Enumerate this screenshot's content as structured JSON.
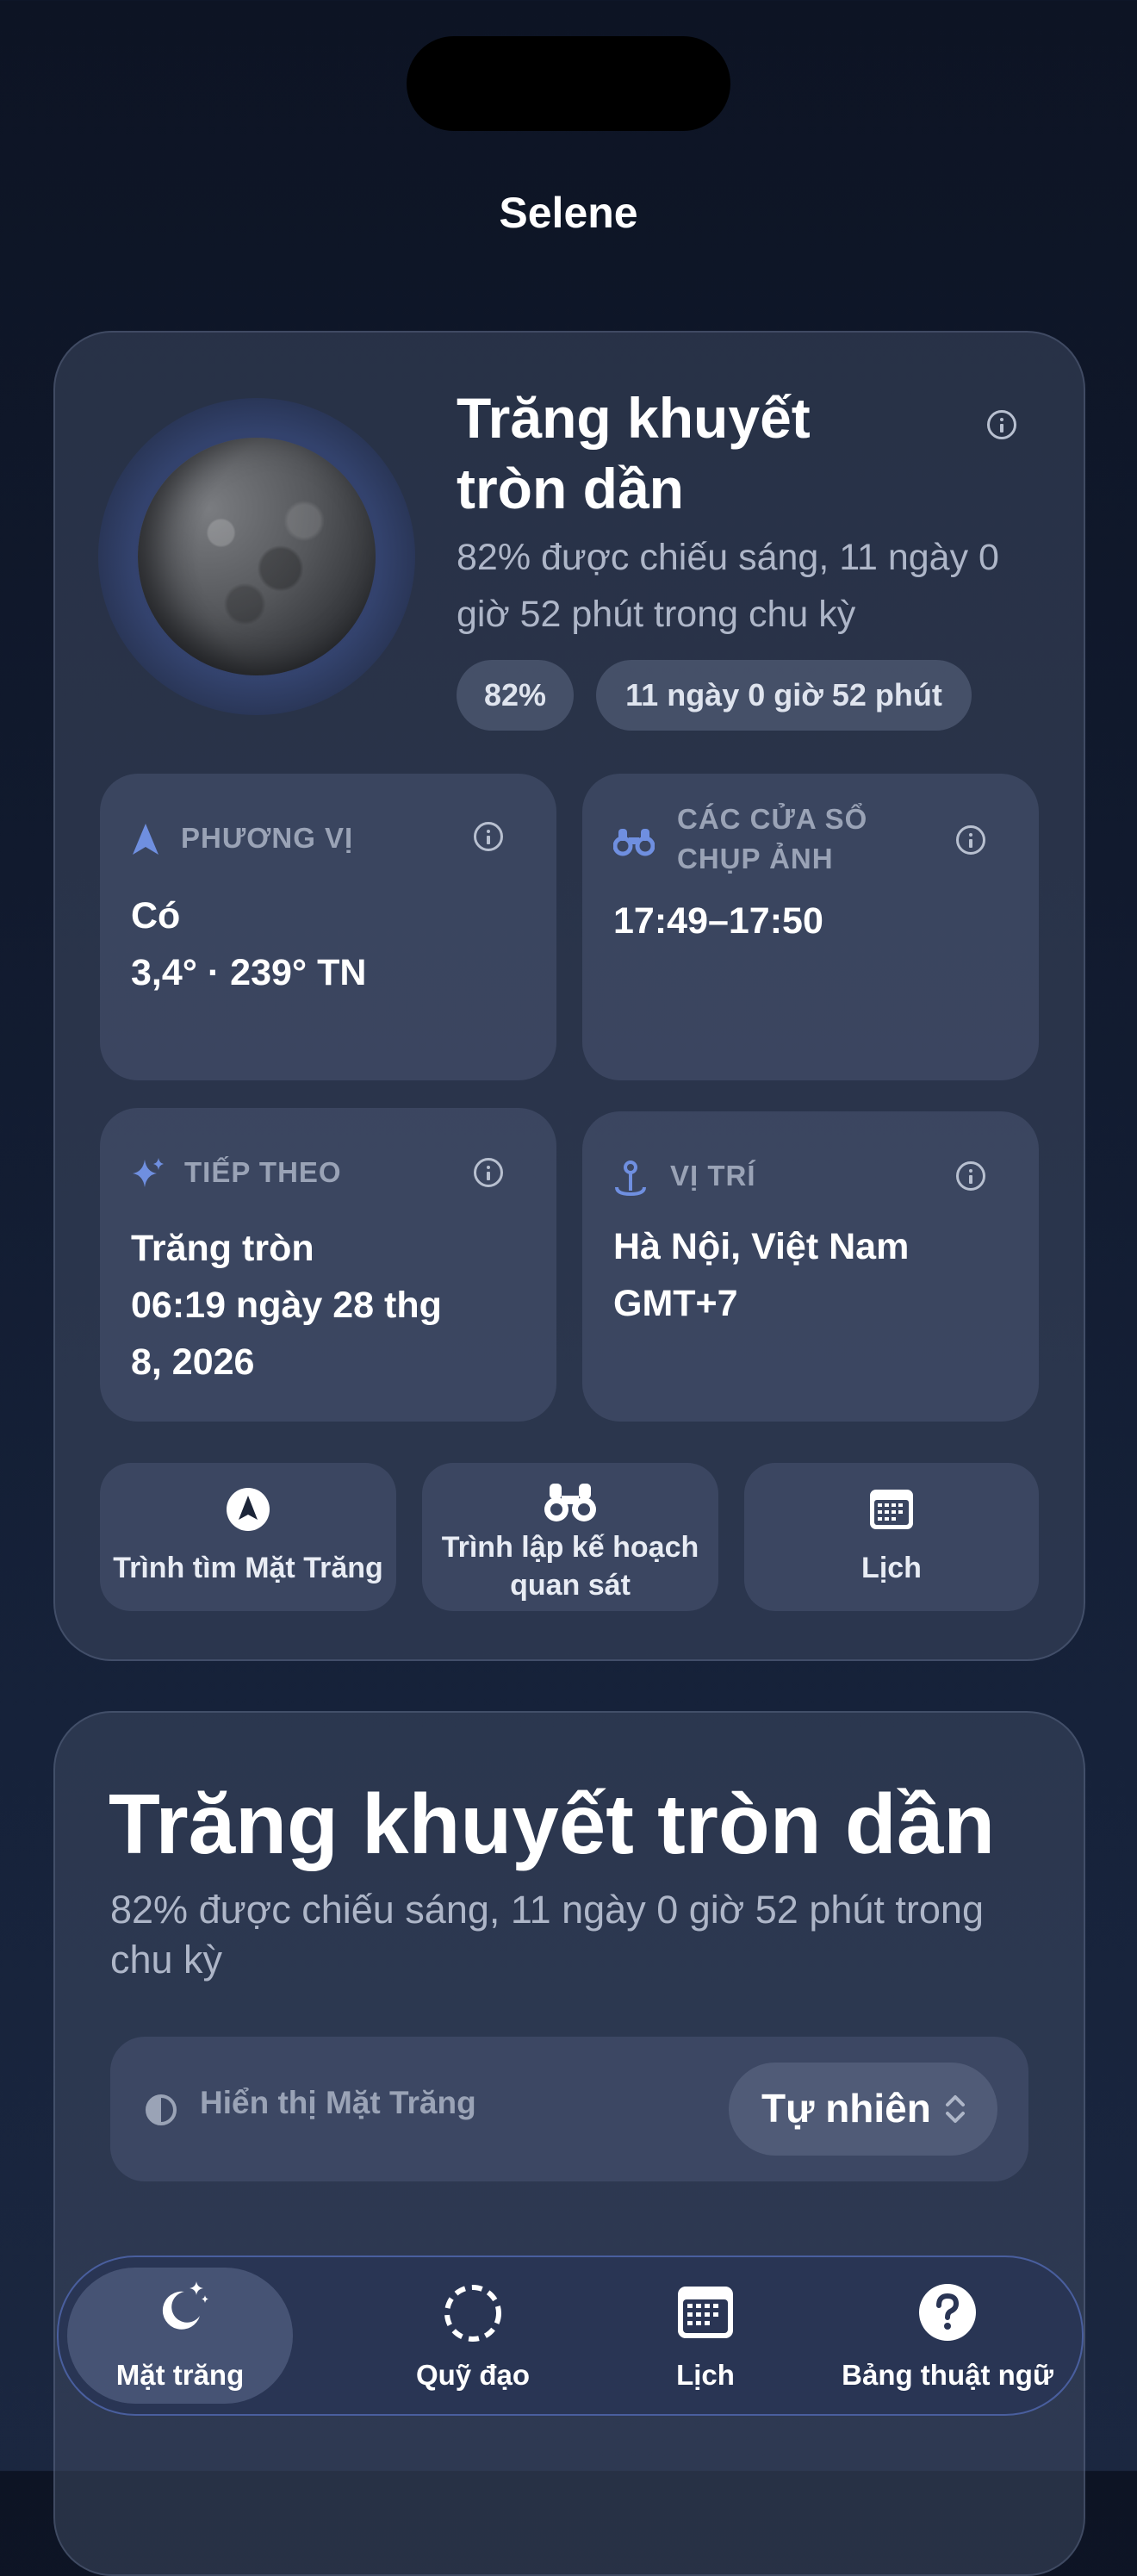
{
  "app": {
    "title": "Selene"
  },
  "phase": {
    "name": "Trăng khuyết tròn dần",
    "name_line1": "Trăng khuyết",
    "name_line2": "tròn dần",
    "subtitle": "82% được chiếu sáng, 11 ngày 0 giờ 52 phút trong chu kỳ",
    "illumination_pill": "82%",
    "age_pill": "11 ngày 0 giờ 52 phút"
  },
  "tiles": {
    "azimuth": {
      "label": "PHƯƠNG VỊ",
      "line1": "Có",
      "line2": "3,4° · 239° TN"
    },
    "photo": {
      "label_line1": "CÁC CỬA SỔ",
      "label_line2": "CHỤP ẢNH",
      "value": "17:49–17:50"
    },
    "next": {
      "label": "TIẾP THEO",
      "line1": "Trăng tròn",
      "line2": "06:19 ngày 28 thg",
      "line3": "8, 2026"
    },
    "location": {
      "label": "VỊ TRÍ",
      "line1": "Hà Nội, Việt Nam",
      "line2": "GMT+7"
    }
  },
  "actions": {
    "finder": "Trình tìm Mặt Trăng",
    "planner_line1": "Trình lập kế hoạch",
    "planner_line2": "quan sát",
    "calendar": "Lịch"
  },
  "detail": {
    "title": "Trăng khuyết tròn dần",
    "subtitle": "82% được chiếu sáng, 11 ngày 0 giờ 52 phút trong chu kỳ",
    "display_label": "Hiển thị Mặt Trăng",
    "display_value": "Tự nhiên"
  },
  "tabbar": {
    "moon": "Mặt trăng",
    "orbit": "Quỹ đạo",
    "calendar": "Lịch",
    "glossary": "Bảng thuật ngữ"
  },
  "colors": {
    "accent": "#6f8fe0",
    "background": "#111a2e"
  }
}
